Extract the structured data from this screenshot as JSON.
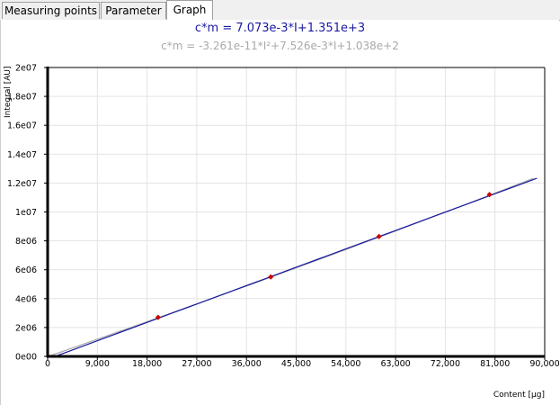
{
  "tabs": [
    {
      "label": "Measuring points",
      "active": false
    },
    {
      "label": "Parameter",
      "active": false
    },
    {
      "label": "Graph",
      "active": true
    }
  ],
  "equations": {
    "linear": "c*m = 7.073e-3*I+1.351e+3",
    "quadratic": "c*m = -3.261e-11*I²+7.526e-3*I+1.038e+2"
  },
  "colors": {
    "linear_fit": "#1a1aa0",
    "quadratic_fit": "#a9a9a9",
    "points": "#cc0000",
    "grid": "#e3e3e3"
  },
  "chart_data": {
    "type": "scatter",
    "xlabel": "Content [µg]",
    "ylabel": "Integral [AU]",
    "xlim": [
      0,
      90000
    ],
    "ylim": [
      0,
      20000000
    ],
    "x_ticks": [
      0,
      9000,
      18000,
      27000,
      36000,
      45000,
      54000,
      63000,
      72000,
      81000,
      90000
    ],
    "x_tick_labels": [
      "0",
      "9,000",
      "18,000",
      "27,000",
      "36,000",
      "45,000",
      "54,000",
      "63,000",
      "72,000",
      "81,000",
      "90,000"
    ],
    "y_ticks": [
      0,
      2000000,
      4000000,
      6000000,
      8000000,
      10000000,
      12000000,
      14000000,
      16000000,
      18000000,
      20000000
    ],
    "y_tick_labels": [
      "0e00",
      "2e06",
      "4e06",
      "6e06",
      "8e06",
      "1e07",
      "1.2e07",
      "1.4e07",
      "1.6e07",
      "1.8e07",
      "2e07"
    ],
    "grid": true,
    "points": [
      {
        "x": 20000,
        "y": 2700000
      },
      {
        "x": 40400,
        "y": 5500000
      },
      {
        "x": 60000,
        "y": 8300000
      },
      {
        "x": 80000,
        "y": 11200000
      }
    ],
    "fits": [
      {
        "kind": "linear",
        "a": 0,
        "b": 0.007073,
        "c": 1351.0
      },
      {
        "kind": "quadratic",
        "a": -3.261e-11,
        "b": 0.007526,
        "c": 103.8
      }
    ]
  }
}
